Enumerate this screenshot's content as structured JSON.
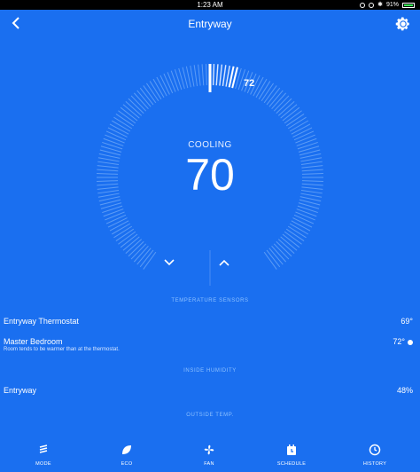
{
  "status": {
    "time": "1:23 AM",
    "battery": "91%"
  },
  "header": {
    "title": "Entryway"
  },
  "thermostat": {
    "mode": "COOLING",
    "current_temp": "70",
    "setpoint": "72",
    "down_label": "⌄",
    "up_label": "⌃"
  },
  "sensors": {
    "heading": "TEMPERATURE SENSORS",
    "items": [
      {
        "name": "Entryway Thermostat",
        "value": "69°",
        "note": ""
      },
      {
        "name": "Master Bedroom",
        "value": "72°",
        "note": "Room tends to be warmer than at the thermostat."
      }
    ]
  },
  "humidity": {
    "heading": "INSIDE HUMIDITY",
    "items": [
      {
        "name": "Entryway",
        "value": "48%"
      }
    ]
  },
  "outside": {
    "heading": "OUTSIDE TEMP."
  },
  "tabs": [
    {
      "label": "MODE",
      "icon": "mode-icon"
    },
    {
      "label": "ECO",
      "icon": "leaf-icon"
    },
    {
      "label": "FAN",
      "icon": "fan-icon"
    },
    {
      "label": "SCHEDULE",
      "icon": "calendar-icon"
    },
    {
      "label": "HISTORY",
      "icon": "clock-icon"
    }
  ],
  "colors": {
    "background": "#1a6ff0",
    "dial_light": "#4d92f5",
    "statusbar": "#000000"
  }
}
